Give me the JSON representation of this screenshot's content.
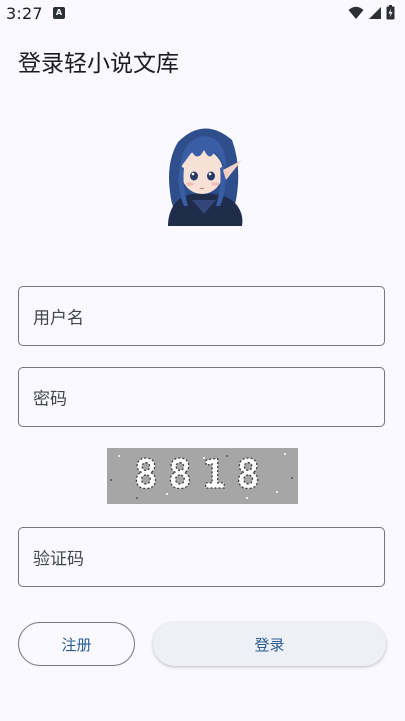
{
  "status_bar": {
    "time": "3:27",
    "notification_glyph": "A",
    "icons": [
      "wifi-icon",
      "signal-icon",
      "battery-icon"
    ]
  },
  "page": {
    "title": "登录轻小说文库"
  },
  "form": {
    "username_placeholder": "用户名",
    "password_placeholder": "密码",
    "captcha_text": "8818",
    "captcha_placeholder": "验证码"
  },
  "buttons": {
    "register": "注册",
    "login": "登录"
  },
  "colors": {
    "background": "#f9f9ff",
    "accent": "#2b5c92",
    "outline": "#73777f",
    "login_button_bg": "#eef0f8",
    "captcha_bg": "#a6a6a6"
  }
}
